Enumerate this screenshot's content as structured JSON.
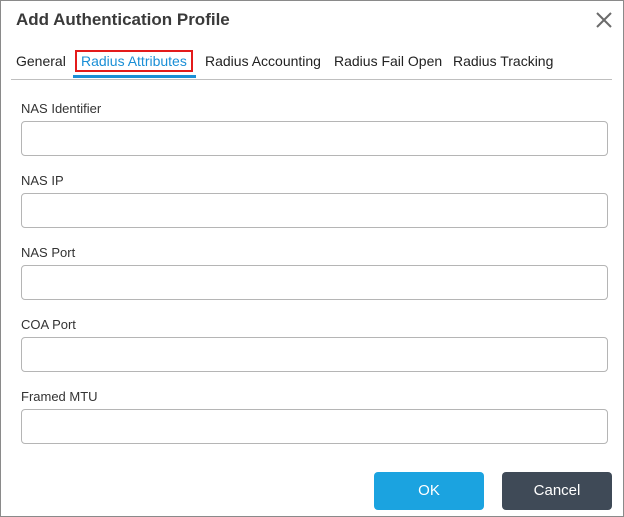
{
  "dialog": {
    "title": "Add Authentication Profile"
  },
  "tabs": [
    {
      "label": "General"
    },
    {
      "label": "Radius Attributes",
      "active": true
    },
    {
      "label": "Radius Accounting"
    },
    {
      "label": "Radius Fail Open"
    },
    {
      "label": "Radius Tracking"
    }
  ],
  "fields": [
    {
      "label": "NAS Identifier",
      "value": "",
      "placeholder": ""
    },
    {
      "label": "NAS IP",
      "value": "",
      "placeholder": ""
    },
    {
      "label": "NAS Port",
      "value": "",
      "placeholder": ""
    },
    {
      "label": "COA Port",
      "value": "",
      "placeholder": ""
    },
    {
      "label": "Framed MTU",
      "value": "",
      "placeholder": ""
    }
  ],
  "buttons": {
    "ok_label": "OK",
    "cancel_label": "Cancel"
  },
  "colors": {
    "active_tab": "#1a8fd6",
    "highlight_box": "#e31b1b",
    "ok_button": "#1ba3e0",
    "cancel_button": "#3f4a57"
  },
  "icons": {
    "close": "close-icon"
  }
}
